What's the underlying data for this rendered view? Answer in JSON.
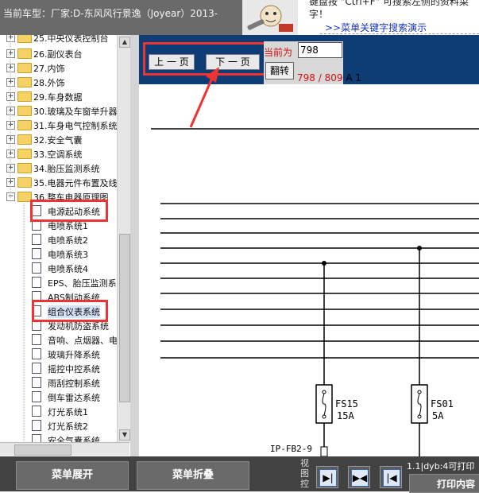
{
  "header": {
    "vehicle_label": "当前车型：厂家:D-东风风行景逸（Joyear）2013-",
    "hint_line1": "键盘按 \"Ctrl+F\" 可搜索左侧的资料菜",
    "hint_line2": "字！",
    "hint_link": ">>菜单关键字搜索演示"
  },
  "tree": {
    "folders": [
      {
        "label": "25.中央仪表控制台",
        "toggle": "+"
      },
      {
        "label": "26.副仪表台",
        "toggle": "+"
      },
      {
        "label": "27.内饰",
        "toggle": "+"
      },
      {
        "label": "28.外饰",
        "toggle": "+"
      },
      {
        "label": "29.车身数据",
        "toggle": "+"
      },
      {
        "label": "30.玻璃及车窗举升器",
        "toggle": "+"
      },
      {
        "label": "31.车身电气控制系统",
        "toggle": "+"
      },
      {
        "label": "32.安全气囊",
        "toggle": "+"
      },
      {
        "label": "33.空调系统",
        "toggle": "+"
      },
      {
        "label": "34.胎压监测系统",
        "toggle": "+"
      },
      {
        "label": "35.电器元件布置及线",
        "toggle": "+"
      },
      {
        "label": "36.整车电器原理图",
        "toggle": "−"
      }
    ],
    "leaves": [
      {
        "label": "电源起动系统"
      },
      {
        "label": "电喷系统1"
      },
      {
        "label": "电喷系统2"
      },
      {
        "label": "电喷系统3"
      },
      {
        "label": "电喷系统4"
      },
      {
        "label": "EPS、胎压监测系"
      },
      {
        "label": "ABS制动系统"
      },
      {
        "label": "组合仪表系统"
      },
      {
        "label": "发动机防盗系统"
      },
      {
        "label": "音响、点烟器、电"
      },
      {
        "label": "玻璃升降系统"
      },
      {
        "label": "摇控中控系统"
      },
      {
        "label": "雨刮控制系统"
      },
      {
        "label": "倒车雷达系统"
      },
      {
        "label": "灯光系统1"
      },
      {
        "label": "灯光系统2"
      },
      {
        "label": "安全气囊系统"
      }
    ]
  },
  "nav": {
    "prev_label": "上 一 页",
    "next_label": "下 一 页",
    "current_label": "当前为",
    "page_input": "798",
    "go_label": "翻转",
    "page_count": "798 / 809",
    "page_suffix": "A 1"
  },
  "diagram": {
    "fuse1_name": "FS15",
    "fuse1_rating": "15A",
    "fuse2_name": "FS01",
    "fuse2_rating": "5A",
    "connector": "IP-FB2-9"
  },
  "bottom": {
    "expand_label": "菜单展开",
    "collapse_label": "菜单折叠",
    "view_label": "视图控",
    "status_text": "1.1|dyb:4可打印",
    "print_label": "打印内容"
  },
  "colors": {
    "nav_bg": "#0e3c75",
    "highlight": "#e33333",
    "page_count": "#d01010"
  }
}
